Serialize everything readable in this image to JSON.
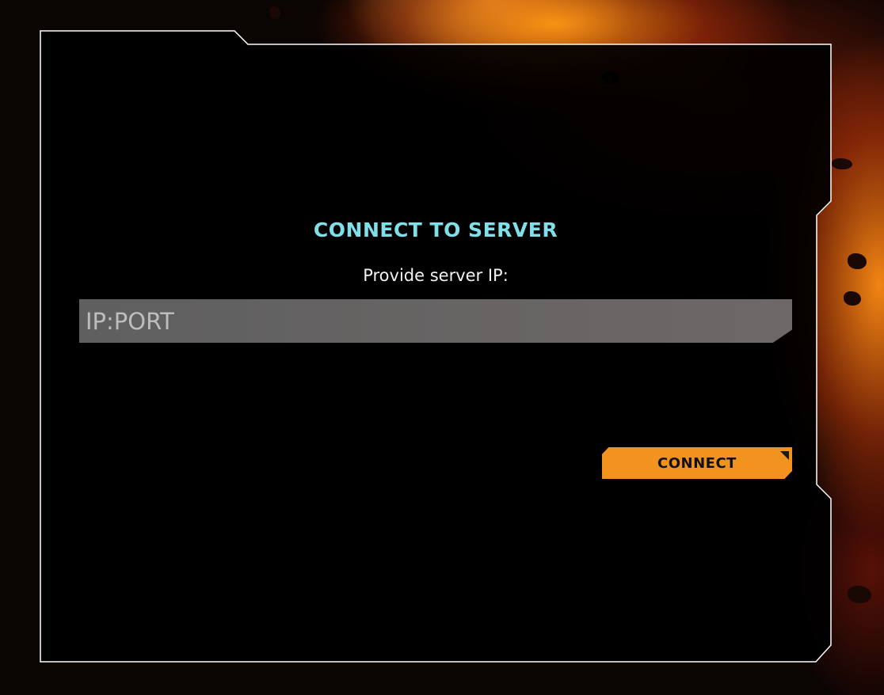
{
  "dialog": {
    "title": "CONNECT TO SERVER",
    "prompt": "Provide server IP:",
    "ip_input": {
      "value": "",
      "placeholder": "IP:PORT"
    },
    "connect_button_label": "CONNECT"
  },
  "colors": {
    "title": "#7fe0e8",
    "button": "#f2921f",
    "panel_border": "#ffffff",
    "panel_fill": "#000000",
    "input_fill": "#666262"
  }
}
